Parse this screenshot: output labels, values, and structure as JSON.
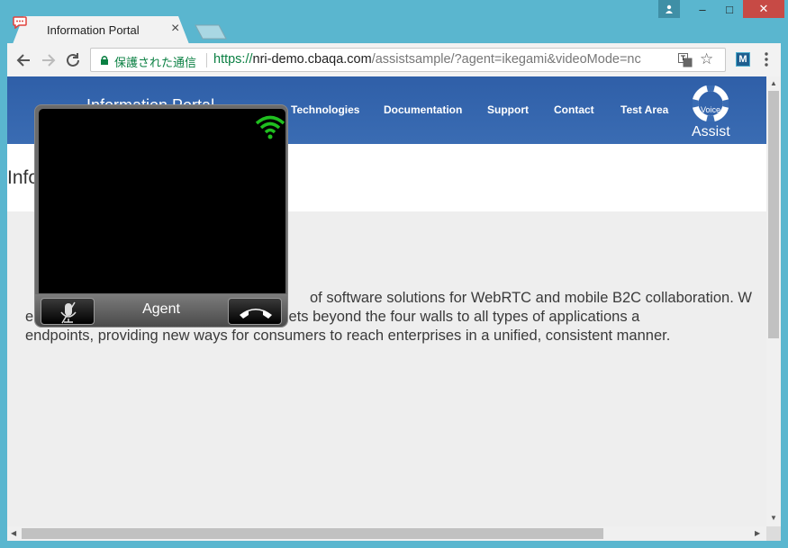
{
  "browser": {
    "tab_title": "Information Portal",
    "tab_close": "×",
    "security_label": "保護された通信",
    "url_scheme": "https://",
    "url_host": "nri-demo.cbaqa.com",
    "url_path": "/assistsample/?agent=ikegami&videoMode=nc",
    "extension_label": "M",
    "window_buttons": [
      "–",
      "□",
      "✕"
    ]
  },
  "site": {
    "brand": "Information Portal",
    "nav": [
      "Technologies",
      "Documentation",
      "Support",
      "Contact",
      "Test Area"
    ],
    "assist_label": "Assist",
    "assist_small": "Voice",
    "page_title": "Info",
    "body_lines": [
      "of software solutions for WebRTC and mobile B2C collaboration. W",
      "e                                         nications assets beyond the four walls to all types of applications a",
      "endpoints, providing new ways for consumers to reach enterprises in a unified, consistent manner."
    ]
  },
  "widget": {
    "agent_label": "Agent",
    "signal_color": "#1fbf1f"
  }
}
